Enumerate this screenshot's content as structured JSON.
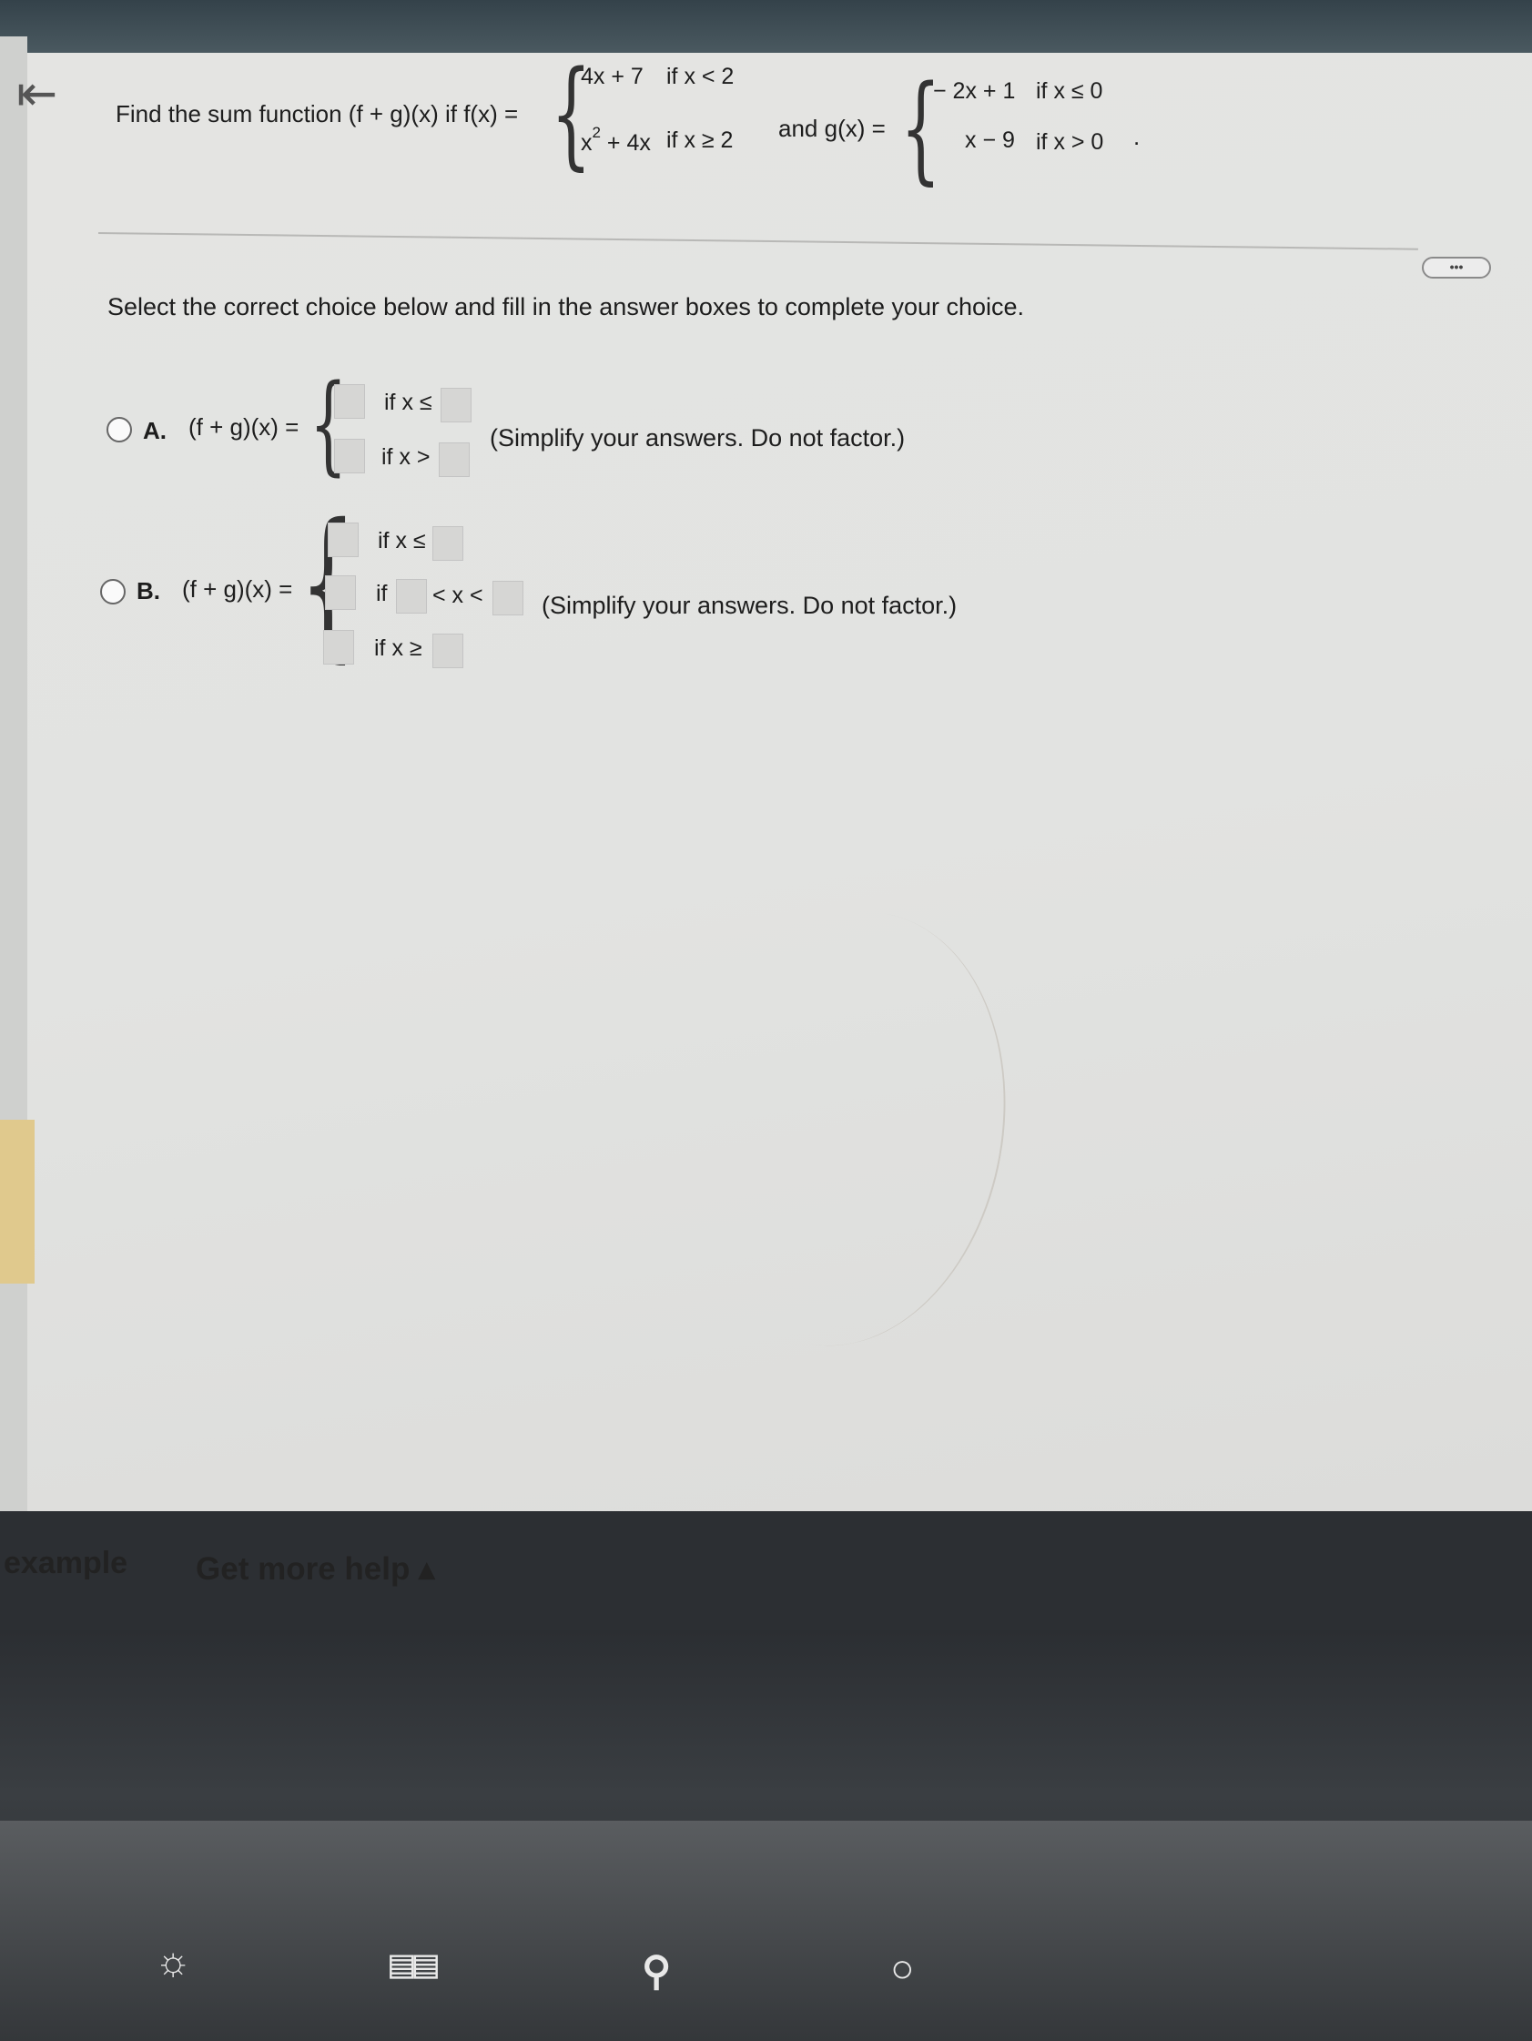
{
  "nav": {
    "back_icon": "⇤"
  },
  "question": {
    "prefix": "Find the sum function (f + g)(x) if f(x) =",
    "f_cases": [
      {
        "expr": "4x + 7",
        "cond": "if x < 2"
      },
      {
        "expr_base": "x",
        "expr_exp": "2",
        "expr_rest": " + 4x",
        "cond": "if x ≥ 2"
      }
    ],
    "and_label": "and g(x) =",
    "g_cases": [
      {
        "expr": "− 2x + 1",
        "cond": "if x ≤ 0"
      },
      {
        "expr": "x − 9",
        "cond": "if x > 0"
      }
    ],
    "period": "."
  },
  "more_button": "•••",
  "instruction": "Select the correct choice below and fill in the answer boxes to complete your choice.",
  "choices": {
    "a": {
      "letter": "A.",
      "expr": "(f + g)(x) =",
      "row1": "if x ≤",
      "row2": "if x >",
      "hint": "(Simplify your answers. Do not factor.)"
    },
    "b": {
      "letter": "B.",
      "expr": "(f + g)(x) =",
      "row1": "if x ≤",
      "row2_if": "if",
      "row2_mid": "< x <",
      "row3": "if x ≥",
      "hint": "(Simplify your answers. Do not factor.)"
    }
  },
  "footer": {
    "example": "example",
    "help": "Get more help ▴"
  }
}
